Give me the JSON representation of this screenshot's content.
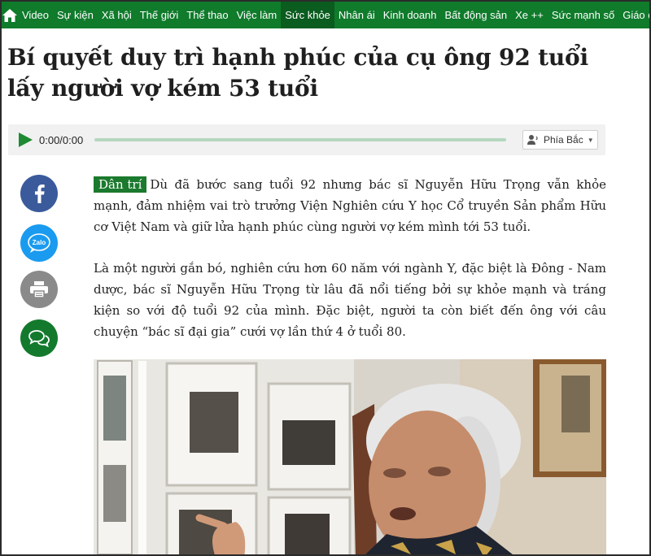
{
  "nav": {
    "items": [
      {
        "label": "Video"
      },
      {
        "label": "Sự kiện"
      },
      {
        "label": "Xã hội"
      },
      {
        "label": "Thế giới"
      },
      {
        "label": "Thể thao"
      },
      {
        "label": "Việc làm"
      },
      {
        "label": "Sức khỏe",
        "active": true
      },
      {
        "label": "Nhân ái"
      },
      {
        "label": "Kinh doanh"
      },
      {
        "label": "Bất động sản"
      },
      {
        "label": "Xe ++"
      },
      {
        "label": "Sức mạnh số"
      },
      {
        "label": "Giáo dục"
      }
    ],
    "background": "#0f7b2b"
  },
  "article": {
    "title": "Bí quyết duy trì hạnh phúc của cụ ông 92 tuổi lấy người vợ kém 53 tuổi",
    "source_badge": "Dân trí",
    "lead": "Dù đã bước sang tuổi 92 nhưng bác sĩ Nguyễn Hữu Trọng vẫn khỏe mạnh, đảm nhiệm vai trò trưởng Viện Nghiên cứu Y học Cổ truyền Sản phẩm Hữu cơ Việt Nam và giữ lửa hạnh phúc cùng người vợ kém mình tới 53 tuổi.",
    "paragraph_2": "Là một người gắn bó, nghiên cứu hơn 60 năm với ngành Y, đặc biệt là Đông - Nam dược, bác sĩ Nguyễn Hữu Trọng từ lâu đã nổi tiếng bởi sự khỏe mạnh và tráng kiện so với độ tuổi 92 của mình. Đặc biệt, người ta còn biết đến ông với câu chuyện “bác sĩ đại gia” cưới vợ lần thứ 4 ở tuổi 80."
  },
  "player": {
    "time": "0:00/0:00",
    "voice": "Phía Bắc",
    "progress": 0
  },
  "social": {
    "zalo_label": "Zalo"
  },
  "colors": {
    "brand_green": "#0f7b2b",
    "facebook": "#3a5a9b",
    "zalo": "#1a9bf0",
    "print": "#8a8a8a"
  }
}
